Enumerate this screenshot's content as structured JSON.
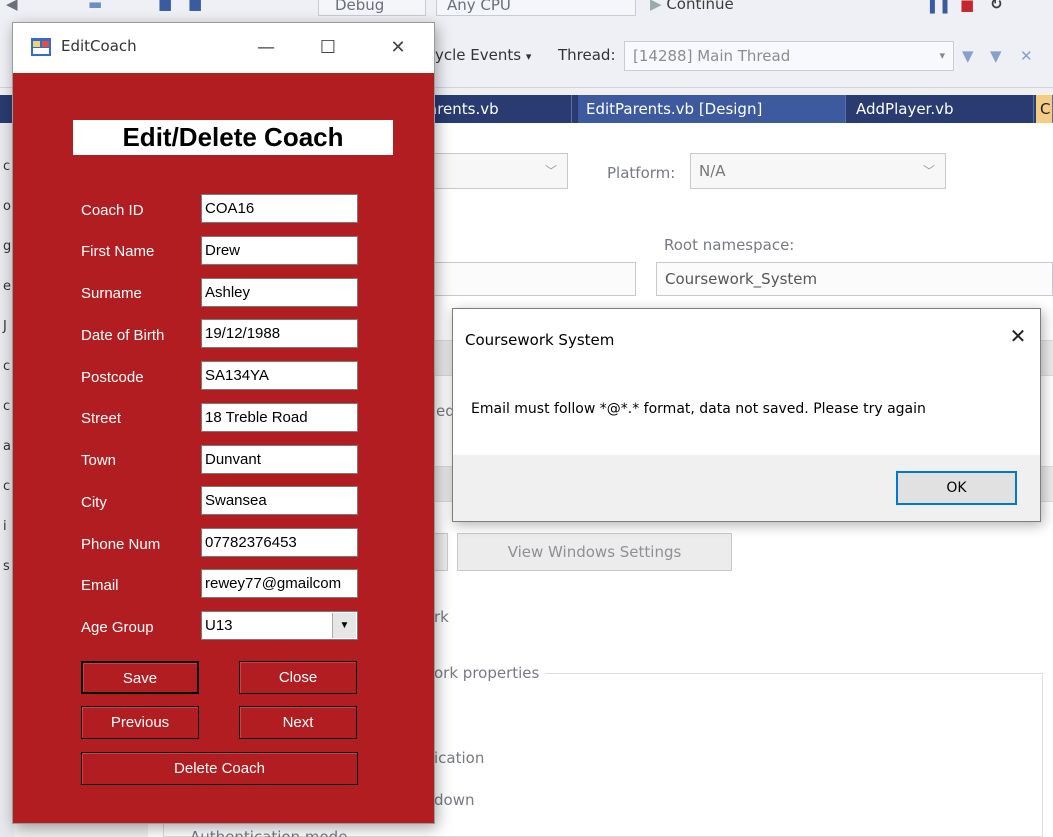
{
  "vs": {
    "toolbar": {
      "config_combo": "Debug",
      "platform_combo": "Any CPU",
      "continue_label": "Continue",
      "lifecycle_label": "ycle Events",
      "thread_label": "Thread:",
      "thread_value": "[14288] Main Thread"
    },
    "tabs": [
      "arents.vb",
      "EditParents.vb [Design]",
      "AddPlayer.vb",
      "C"
    ],
    "left_strip": [
      "c",
      "o",
      "g",
      "e",
      "J",
      "c",
      "c",
      "a",
      "c",
      "i",
      "s"
    ],
    "props": {
      "platform_label": "Platform:",
      "platform_value": "N/A",
      "root_namespace_label": "Root namespace:",
      "root_namespace_value": "Coursework_System",
      "frag_ed": "ed",
      "view_windows_settings": "View Windows Settings",
      "frag_rk": "rk",
      "frag_framework_props": "ork properties",
      "frag_ication": "ication",
      "frag_down": "down",
      "frag_bottom": "Authentication mode"
    }
  },
  "form": {
    "window_title": "EditCoach",
    "heading": "Edit/Delete Coach",
    "fields": [
      {
        "label": "Coach ID",
        "value": "COA16"
      },
      {
        "label": "First Name",
        "value": "Drew"
      },
      {
        "label": "Surname",
        "value": "Ashley"
      },
      {
        "label": "Date of Birth",
        "value": "19/12/1988"
      },
      {
        "label": "Postcode",
        "value": "SA134YA"
      },
      {
        "label": "Street",
        "value": "18 Treble Road"
      },
      {
        "label": "Town",
        "value": "Dunvant"
      },
      {
        "label": "City",
        "value": "Swansea"
      },
      {
        "label": "Phone Num",
        "value": "07782376453"
      },
      {
        "label": "Email",
        "value": "rewey77@gmailcom"
      }
    ],
    "age_group_label": "Age Group",
    "age_group_value": "U13",
    "buttons": {
      "save": "Save",
      "close": "Close",
      "previous": "Previous",
      "next": "Next",
      "delete": "Delete Coach"
    }
  },
  "dialog": {
    "title": "Coursework System",
    "message": "Email must follow *@*.* format, data not saved. Please try again",
    "ok": "OK"
  }
}
